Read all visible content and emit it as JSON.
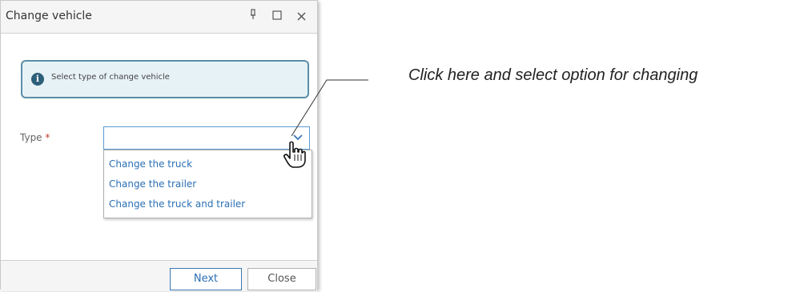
{
  "dialog": {
    "title": "Change vehicle",
    "titlebar_buttons": [
      "pin-icon",
      "maximize-icon",
      "close-icon"
    ],
    "info_message": "Select type of change vehicle",
    "type_field": {
      "label": "Type",
      "required_marker": "*",
      "value": "",
      "options": [
        "Change the truck",
        "Change the trailer",
        "Change the truck and trailer"
      ]
    },
    "buttons": {
      "next": "Next",
      "close": "Close"
    }
  },
  "annotation": {
    "text": "Click here and select option for changing"
  },
  "colors": {
    "accent": "#3a78b5",
    "info_border": "#5a8fa8",
    "info_background": "#e7f2f6",
    "required": "#c0392b"
  }
}
